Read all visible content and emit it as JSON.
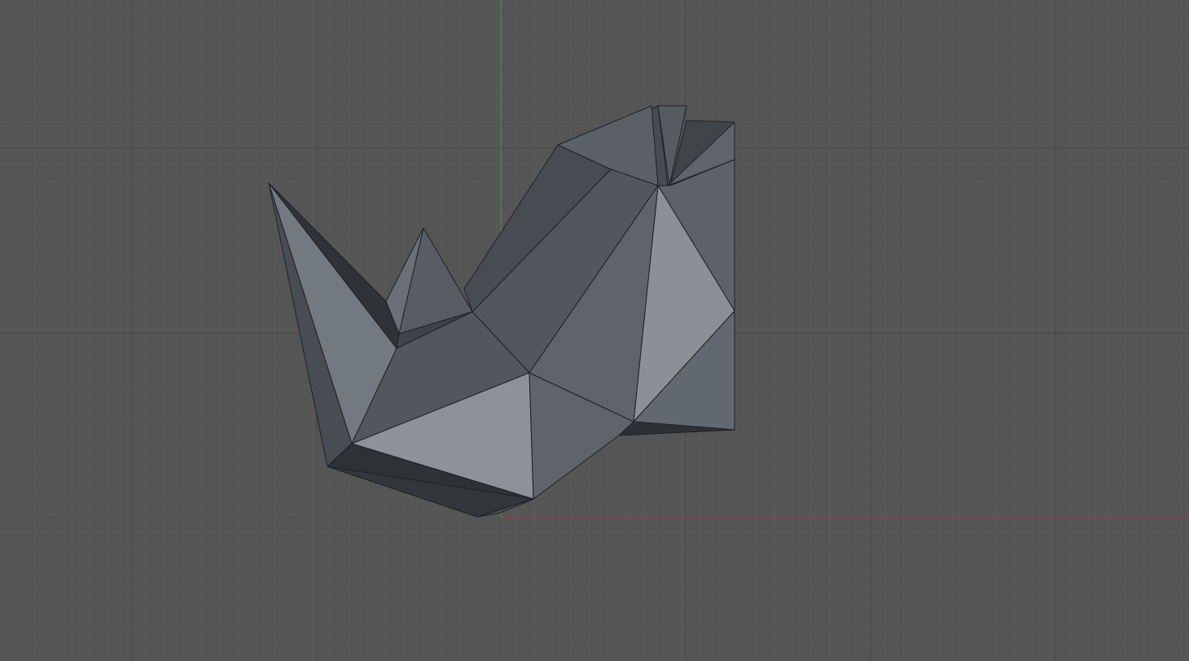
{
  "viewport": {
    "background": "#555555",
    "grid_minor_color": "#5c5c5c",
    "grid_major_color": "#484848",
    "axis_x_color": "#b0334a",
    "axis_y_color": "#3c9a3c",
    "view": "top-orthographic",
    "shading": "solid"
  },
  "object": {
    "type": "low-poly mesh",
    "shape": "rhino-head",
    "base_color": "#6b7177",
    "outline_color": "#1e2124"
  }
}
